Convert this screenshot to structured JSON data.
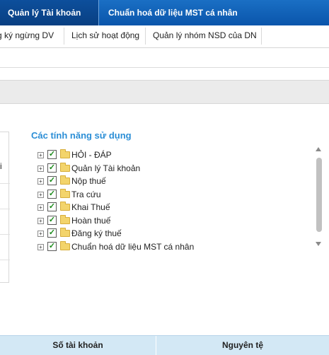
{
  "top_tabs": [
    {
      "label": "Quản lý Tài khoản",
      "active": true
    },
    {
      "label": "Chuẩn hoá dữ liệu MST cá nhân",
      "active": false
    }
  ],
  "sub_tabs": [
    {
      "label": "g ký ngừng DV"
    },
    {
      "label": "Lịch sử hoạt động"
    },
    {
      "label": "Quản lý nhóm NSD của DN"
    }
  ],
  "left_form": {
    "visible_char": "i"
  },
  "features": {
    "title": "Các tính năng sử dụng",
    "items": [
      {
        "label": "HỎI - ĐÁP",
        "checked": true,
        "icon": "folder-icon"
      },
      {
        "label": "Quản lý Tài khoản",
        "checked": true,
        "icon": "folder-icon"
      },
      {
        "label": "Nộp thuế",
        "checked": true,
        "icon": "folder-icon"
      },
      {
        "label": "Tra cứu",
        "checked": true,
        "icon": "folder-icon"
      },
      {
        "label": "Khai Thuế",
        "checked": true,
        "icon": "folder-icon"
      },
      {
        "label": "Hoàn thuế",
        "checked": true,
        "icon": "folder-icon"
      },
      {
        "label": "Đăng ký thuế",
        "checked": true,
        "icon": "folder-icon"
      },
      {
        "label": "Chuẩn hoá dữ liệu MST cá nhân",
        "checked": true,
        "icon": "folder-icon"
      }
    ]
  },
  "table": {
    "columns": [
      "Số tài khoản",
      "Nguyên tệ"
    ]
  },
  "colors": {
    "top_bar": "#0a55ab",
    "section_title": "#2b8ed6",
    "table_header": "#d3e8f5"
  }
}
